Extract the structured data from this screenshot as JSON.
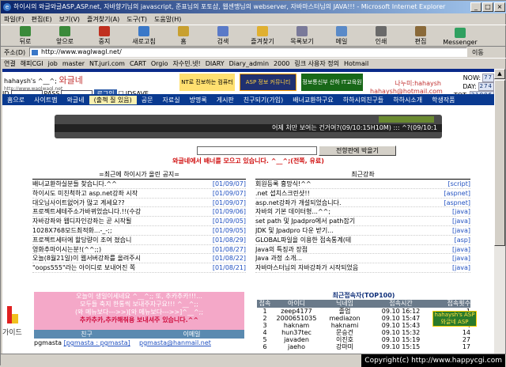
{
  "window": {
    "title": "하이시의 와글와글ASP,ASP.net, 자바향기님의 javascript, 준표님의 포토샵, 웹센맹님의 webserver, 자바마스터님의 JAVA!!! - Microsoft Internet Explorer"
  },
  "menu": [
    "파일(F)",
    "편집(E)",
    "보기(V)",
    "즐겨찾기(A)",
    "도구(T)",
    "도움말(H)"
  ],
  "toolbar": [
    {
      "label": "뒤로",
      "icon": "back-icon"
    },
    {
      "label": "앞으로",
      "icon": "forward-icon"
    },
    {
      "label": "중지",
      "icon": "stop-icon"
    },
    {
      "label": "새로고침",
      "icon": "refresh-icon"
    },
    {
      "label": "홈",
      "icon": "home-icon"
    },
    {
      "label": "검색",
      "icon": "search-icon"
    },
    {
      "label": "즐겨찾기",
      "icon": "favorites-icon"
    },
    {
      "label": "목록보기",
      "icon": "history-icon"
    },
    {
      "label": "메일",
      "icon": "mail-icon"
    },
    {
      "label": "인쇄",
      "icon": "print-icon"
    },
    {
      "label": "편집",
      "icon": "edit-icon"
    },
    {
      "label": "Messenger",
      "icon": "messenger-icon"
    }
  ],
  "address": {
    "label": "주소(D)",
    "url": "http://www.waglwagl.net/",
    "go": "이동"
  },
  "links": {
    "label": "연결",
    "items": [
      "해피CGI",
      "job",
      "master",
      "NT.juri.com",
      "CART",
      "Orgio",
      "자수민.넷!",
      "DIARY",
      "Diary_admin",
      "2000",
      "링크 사용자 정의",
      "Hotmail"
    ]
  },
  "site": {
    "logo_small": "hahaysh's ^__^;",
    "logo_big": "와글네",
    "logo_url": "http://www.waglwagl.net",
    "banner1": "NT로 진보하는 컴퓨터",
    "banner2": "ASP 정보 커뮤니티",
    "banner3": "정보통신부 산하 IT교육원",
    "nickname": "나누미:hahaysh",
    "email": "hahaysh@hotmail.com",
    "now_label": "NOW:",
    "now": "77",
    "day_label": "DAY:",
    "day": "274",
    "tot_label": "TOT:",
    "tot": "31006",
    "login": {
      "id": "ID",
      "pass": "PASS",
      "btn": "로그인",
      "save": "IDSAVE"
    },
    "nav": [
      "홈으로",
      "사이트맵",
      "와글네",
      "(출첵 질 있음)",
      "공문",
      "자료실",
      "방명록",
      "게시판",
      "친구되기(가입)",
      "배너교환하구요",
      "하하시의친구들",
      "하하시소개",
      "학생작품"
    ],
    "marquee": "어제 처만 보여는 건거여?(09/10:15H10M) ::: ^?(09/10:1",
    "banner_btn": "전향판에 박을기",
    "banner_note": "와글네에서 배너를 모으고 있습니다. ^__^;(전쪽, 유료)",
    "left_title": "=최근에 하이시가 올린 공지=",
    "left_items": [
      [
        "배너교환하실분들 찾습니다.^^",
        "[01/09/07]"
      ],
      [
        "하이시도 미친척하고 asp.net강좌 시작",
        "[01/09/07]"
      ],
      [
        "대오님사이트없어가 많고 계세요??",
        "[01/09/07]"
      ],
      [
        "프로젝트세테주소가바뀌었습니다.!!(수강",
        "[01/09/06]"
      ],
      [
        "자바강좌와 웹디자인강좌는 곧 시작될",
        "[01/09/05]"
      ],
      [
        "1028X768모드최적화...-_-;;",
        "[01/09/05]"
      ],
      [
        "프로젝트세터에 할당량이 조여 졌습니",
        "[01/08/29]"
      ],
      [
        "영화추마이시는분!(^^;;)",
        "[01/08/27]"
      ],
      [
        "오늘(8월21일)이 웹서버강좌를 올려주시",
        "[01/08/22]"
      ],
      [
        "\"oops555\"라는 아이디로 보내어진 쪽",
        "[01/08/21]"
      ]
    ],
    "right_title": "최근강좌",
    "right_items": [
      [
        "회원등록 흉망식!^^",
        "[script]"
      ],
      [
        ".net 셥치스크린샷!!",
        "[aspnet]"
      ],
      [
        "asp.net강좌가 개설되었습니다.",
        "[aspnet]"
      ],
      [
        "자바의 기본 데이터형...^^;",
        "[java]"
      ],
      [
        "set path 및 Jpadpro에서 path잡기",
        "[java]"
      ],
      [
        "JDK 및 Jpadpro 다운 받기...",
        "[java]"
      ],
      [
        "GLOBAL파일을 이용한 접속통계(테",
        "[asp]"
      ],
      [
        "Java의 특징과 장점",
        "[java]"
      ],
      [
        "Java 과정 소개...",
        "[java]"
      ],
      [
        "자바마스터님의 자바강좌가 시작되었음",
        "[java]"
      ]
    ],
    "visit_lines": [
      "오늘이 생일이세네요 ^__^;; 또, 추카추카!!!...",
      "모두들 축지 한통씩 보내주자구요!!! ^__^;;",
      "(와 메뉴보다--->>)[와 메뉴보다--->>]^__^;;"
    ],
    "visit_bold": "추카추카,추카해줘용 보내셔주 있습니다.^^",
    "tbl_head": [
      "친구",
      "이메일"
    ],
    "tbl_row": [
      "pgmasta",
      "[pgmasta : pgmasta]",
      "pgmasta@hanmail.net"
    ],
    "recent_title": "최근접속자(TOP100)",
    "recent_head": [
      "접속",
      "아이디",
      "닉네임",
      "접속시간",
      "접속횟수"
    ],
    "recent_rows": [
      [
        "1",
        "zeep4177",
        "졸업",
        "09.10 16:12",
        "1"
      ],
      [
        "2",
        "2000651035",
        "mediazon",
        "09.10 15:47",
        "73"
      ],
      [
        "3",
        "haknam",
        "haknami",
        "09.10 15:43",
        "4"
      ],
      [
        "4",
        "hun37tec",
        "문승건",
        "09.10 15:32",
        "14"
      ],
      [
        "5",
        "javaden",
        "이진호",
        "09.10 15:19",
        "27"
      ],
      [
        "6",
        "jaeho",
        "강마미",
        "09.10 15:15",
        "17"
      ]
    ],
    "hbadge": "hahaysh's ASP 와글네 ASP",
    "leftbit": "가이드"
  },
  "status": {
    "copyright": "Copyright(c) http://www.happycgi.com"
  },
  "colors": {
    "nav": "#0a3a90",
    "accent": "#d01010",
    "link": "#2050c0"
  }
}
